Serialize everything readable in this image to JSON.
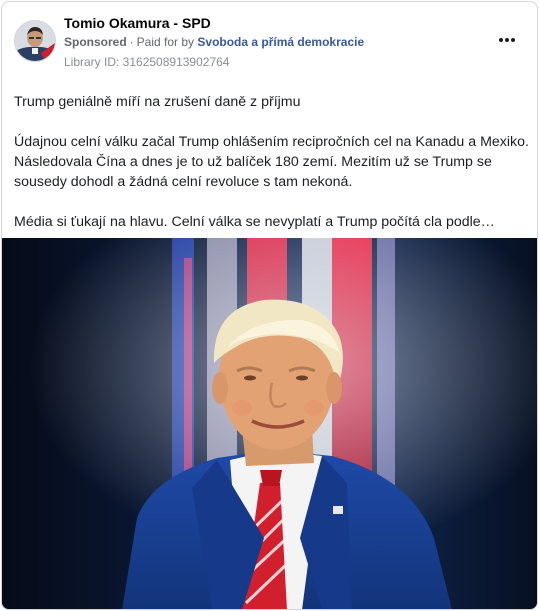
{
  "post": {
    "page_name": "Tomio Okamura - SPD",
    "sponsored_label": "Sponsored",
    "separator": "·",
    "paid_for_prefix": "Paid for by",
    "payer_name": "Svoboda a přímá demokracie",
    "library_id": "Library ID: 3162508913902764",
    "more_icon": "more-horizontal-icon",
    "paragraphs": [
      "Trump geniálně míří na zrušení daně z příjmu",
      "Údajnou celní válku začal Trump ohlášením recipročních cel na Kanadu a Mexiko. Následovala Čína a dnes je to už balíček 180 zemí. Mezitím už se Trump se sousedy dohodl a žádná celní revoluce s tam nekoná.",
      "Média si ťukají na hlavu. Celní válka se nevyplatí a Trump počítá cla podle…"
    ]
  },
  "colors": {
    "payer_link": "#385898",
    "muted": "#65676b",
    "border": "#d4d6da"
  }
}
